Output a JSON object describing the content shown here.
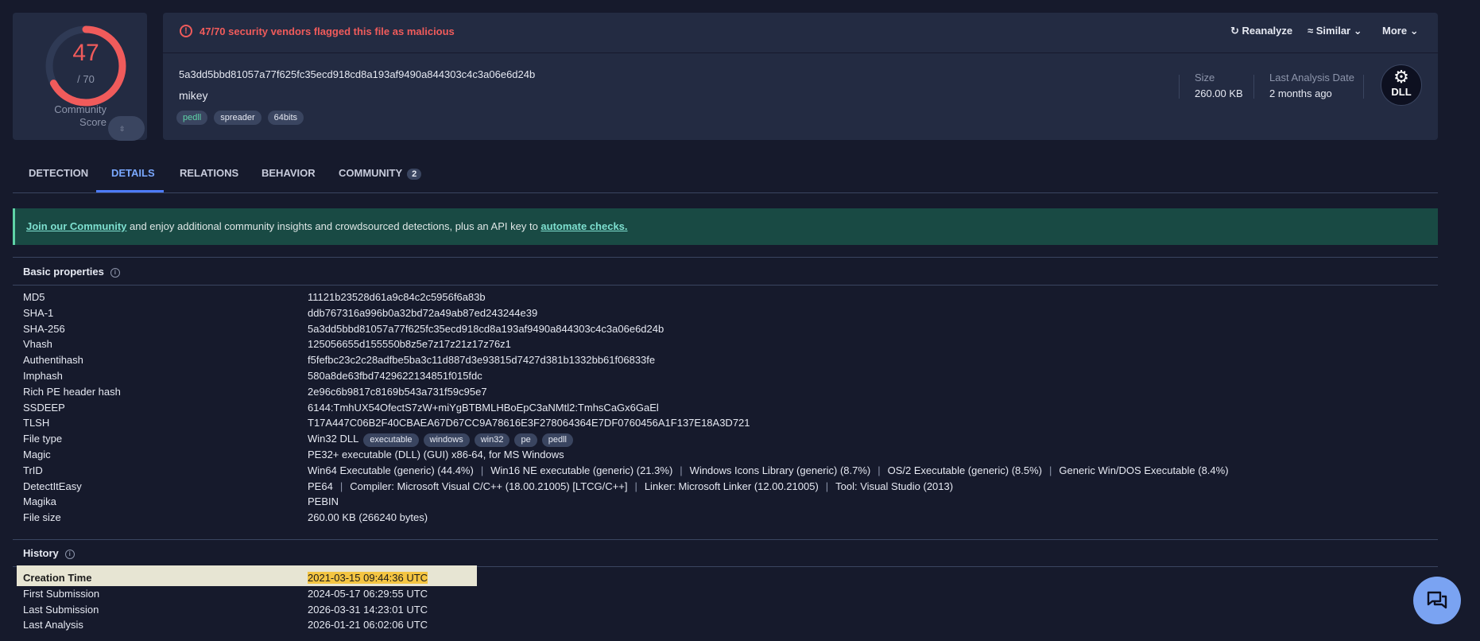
{
  "score": {
    "detected": "47",
    "total": "/ 70",
    "community_label": "Community Score"
  },
  "alert": {
    "text": "47/70 security vendors flagged this file as malicious"
  },
  "actions": {
    "reanalyze": "Reanalyze",
    "similar": "Similar",
    "more": "More"
  },
  "file": {
    "hash": "5a3dd5bbd81057a77f625fc35ecd918cd8a193af9490a844303c4c3a06e6d24b",
    "name": "mikey",
    "tags": [
      "pedll",
      "spreader",
      "64bits"
    ],
    "size_label": "Size",
    "size_value": "260.00 KB",
    "last_analysis_label": "Last Analysis Date",
    "last_analysis_value": "2 months ago",
    "type_badge": "DLL"
  },
  "tabs": [
    {
      "label": "DETECTION"
    },
    {
      "label": "DETAILS"
    },
    {
      "label": "RELATIONS"
    },
    {
      "label": "BEHAVIOR"
    },
    {
      "label": "COMMUNITY",
      "badge": "2"
    }
  ],
  "banner": {
    "link1": "Join our Community",
    "middle": " and enjoy additional community insights and crowdsourced detections, plus an API key to ",
    "link2": "automate checks."
  },
  "basic": {
    "title": "Basic properties",
    "rows": [
      {
        "k": "MD5",
        "v": "11121b23528d61a9c84c2c5956f6a83b"
      },
      {
        "k": "SHA-1",
        "v": "ddb767316a996b0a32bd72a49ab87ed243244e39"
      },
      {
        "k": "SHA-256",
        "v": "5a3dd5bbd81057a77f625fc35ecd918cd8a193af9490a844303c4c3a06e6d24b"
      },
      {
        "k": "Vhash",
        "v": "125056655d155550b8z5e7z17z21z17z76z1"
      },
      {
        "k": "Authentihash",
        "v": "f5fefbc23c2c28adfbe5ba3c11d887d3e93815d7427d381b1332bb61f06833fe"
      },
      {
        "k": "Imphash",
        "v": "580a8de63fbd7429622134851f015fdc"
      },
      {
        "k": "Rich PE header hash",
        "v": "2e96c6b9817c8169b543a731f59c95e7"
      },
      {
        "k": "SSDEEP",
        "v": "6144:TmhUX54OfectS7zW+miYgBTBMLHBoEpC3aNMtl2:TmhsCaGx6GaEl"
      },
      {
        "k": "TLSH",
        "v": "T17A447C06B2F40CBAEA67D67CC9A78616E3F278064364E7DF0760456A1F137E18A3D721"
      },
      {
        "k": "File type",
        "v": "Win32 DLL",
        "chips": [
          "executable",
          "windows",
          "win32",
          "pe",
          "pedll"
        ]
      },
      {
        "k": "Magic",
        "v": "PE32+ executable (DLL) (GUI) x86-64, for MS Windows"
      },
      {
        "k": "TrID",
        "parts": [
          "Win64 Executable (generic) (44.4%)",
          "Win16 NE executable (generic) (21.3%)",
          "Windows Icons Library (generic) (8.7%)",
          "OS/2 Executable (generic) (8.5%)",
          "Generic Win/DOS Executable (8.4%)"
        ]
      },
      {
        "k": "DetectItEasy",
        "parts": [
          "PE64",
          "Compiler: Microsoft Visual C/C++ (18.00.21005) [LTCG/C++]",
          "Linker: Microsoft Linker (12.00.21005)",
          "Tool: Visual Studio (2013)"
        ]
      },
      {
        "k": "Magika",
        "v": "PEBIN"
      },
      {
        "k": "File size",
        "v": "260.00 KB (266240 bytes)"
      }
    ]
  },
  "history": {
    "title": "History",
    "rows": [
      {
        "k": "Creation Time",
        "v": "2021-03-15 09:44:36 UTC"
      },
      {
        "k": "First Submission",
        "v": "2024-05-17 06:29:55 UTC"
      },
      {
        "k": "Last Submission",
        "v": "2026-03-31 14:23:01 UTC"
      },
      {
        "k": "Last Analysis",
        "v": "2026-01-21 06:02:06 UTC"
      }
    ]
  },
  "colors": {
    "malicious": "#f05b5b",
    "accent": "#4d7cfe",
    "banner_bg": "#194a44",
    "highlight": "#f4c542"
  },
  "score_fraction": 0.671
}
